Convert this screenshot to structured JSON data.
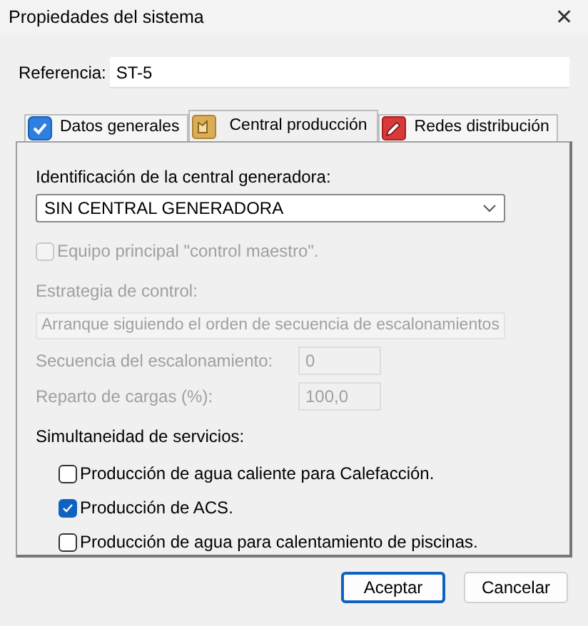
{
  "window": {
    "title": "Propiedades del sistema",
    "close": "✕"
  },
  "reference": {
    "label": "Referencia:",
    "value": "ST-5"
  },
  "tabs": [
    {
      "label": "Datos generales",
      "kind": "check",
      "selected": false
    },
    {
      "label": "Central producción",
      "kind": "plant",
      "selected": true
    },
    {
      "label": "Redes distribución",
      "kind": "pencil",
      "selected": false
    }
  ],
  "plant": {
    "label": "Identificación de la central generadora:",
    "value": "SIN CENTRAL GENERADORA",
    "disabled": false
  },
  "master": {
    "label": "Equipo principal \"control maestro\".",
    "checked": false,
    "disabled": true
  },
  "strategy": {
    "label": "Estrategia de control:",
    "value": "Arranque siguiendo el orden de secuencia de escalonamientos",
    "disabled": true
  },
  "fields": [
    {
      "label": "Secuencia del escalonamiento:",
      "value": "0",
      "disabled": true
    },
    {
      "label": "Reparto de cargas (%):",
      "value": "100,0",
      "disabled": true
    }
  ],
  "services": {
    "label": "Simultaneidad de servicios:",
    "items": [
      {
        "label": "Producción de agua caliente para Calefacción.",
        "checked": false
      },
      {
        "label": "Producción de ACS.",
        "checked": true
      },
      {
        "label": "Producción de agua para calentamiento de piscinas.",
        "checked": false
      }
    ]
  },
  "buttons": [
    {
      "label": "Aceptar",
      "selected": true
    },
    {
      "label": "Cancelar",
      "selected": false
    }
  ]
}
